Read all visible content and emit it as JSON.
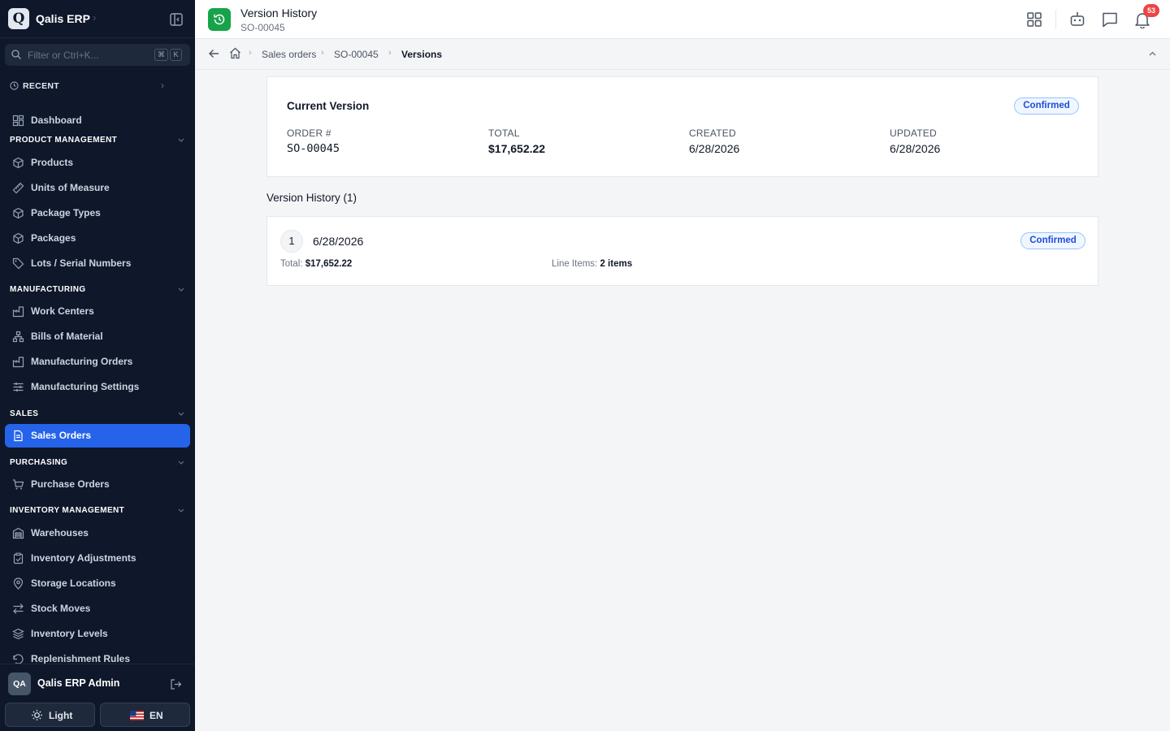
{
  "app": {
    "logo_letter": "Q",
    "name": "Qalis ERP"
  },
  "filter": {
    "placeholder": "Filter or Ctrl+K...",
    "kbd1": "⌘",
    "kbd2": "K"
  },
  "recent_label": "RECENT",
  "sidebar": {
    "dashboard": "Dashboard",
    "sections": {
      "product": "PRODUCT MANAGEMENT",
      "manufacturing": "MANUFACTURING",
      "sales": "SALES",
      "purchasing": "PURCHASING",
      "inventory": "INVENTORY MANAGEMENT"
    },
    "items": {
      "products": "Products",
      "uom": "Units of Measure",
      "package_types": "Package Types",
      "packages": "Packages",
      "lots": "Lots / Serial Numbers",
      "work_centers": "Work Centers",
      "bom": "Bills of Material",
      "mfg_orders": "Manufacturing Orders",
      "mfg_settings": "Manufacturing Settings",
      "sales_orders": "Sales Orders",
      "purchase_orders": "Purchase Orders",
      "warehouses": "Warehouses",
      "inv_adjust": "Inventory Adjustments",
      "storage_loc": "Storage Locations",
      "stock_moves": "Stock Moves",
      "inv_levels": "Inventory Levels",
      "replenish": "Replenishment Rules"
    }
  },
  "user": {
    "initials": "QA",
    "name": "Qalis ERP Admin"
  },
  "theme_button": "Light",
  "lang_button": "EN",
  "header": {
    "title": "Version History",
    "subtitle": "SO-00045",
    "notif_count": "53"
  },
  "breadcrumb": {
    "c1": "Sales orders",
    "c2": "SO-00045",
    "c3": "Versions"
  },
  "current": {
    "title": "Current Version",
    "status": "Confirmed",
    "order_label": "ORDER #",
    "order_value": "SO-00045",
    "total_label": "TOTAL",
    "total_value": "$17,652.22",
    "created_label": "CREATED",
    "created_value": "6/28/2026",
    "updated_label": "UPDATED",
    "updated_value": "6/28/2026"
  },
  "history": {
    "heading": "Version History (1)",
    "versions": [
      {
        "num": "1",
        "date": "6/28/2026",
        "status": "Confirmed",
        "total_label": "Total:",
        "total": "$17,652.22",
        "items_label": "Line Items:",
        "items": "2 items"
      }
    ]
  },
  "colors": {
    "sidebar_bg": "#0f172a",
    "accent": "#2563eb",
    "page_icon": "#16a34a",
    "badge": "#1d4ed8",
    "notif": "#ef4444"
  }
}
